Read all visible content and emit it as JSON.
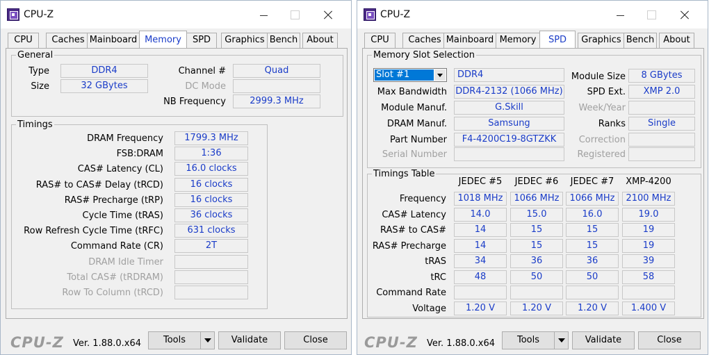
{
  "left_window": {
    "title": "CPU-Z",
    "tabs": [
      "CPU",
      "Caches",
      "Mainboard",
      "Memory",
      "SPD",
      "Graphics",
      "Bench",
      "About"
    ],
    "active_tab": "Memory",
    "general": {
      "legend": "General",
      "type_label": "Type",
      "type_value": "DDR4",
      "size_label": "Size",
      "size_value": "32 GBytes",
      "channel_label": "Channel #",
      "channel_value": "Quad",
      "dcmode_label": "DC Mode",
      "dcmode_value": "",
      "nbfreq_label": "NB Frequency",
      "nbfreq_value": "2999.3 MHz"
    },
    "timings": {
      "legend": "Timings",
      "rows": [
        {
          "label": "DRAM Frequency",
          "value": "1799.3 MHz",
          "disabled": false
        },
        {
          "label": "FSB:DRAM",
          "value": "1:36",
          "disabled": false
        },
        {
          "label": "CAS# Latency (CL)",
          "value": "16.0 clocks",
          "disabled": false
        },
        {
          "label": "RAS# to CAS# Delay (tRCD)",
          "value": "16 clocks",
          "disabled": false
        },
        {
          "label": "RAS# Precharge (tRP)",
          "value": "16 clocks",
          "disabled": false
        },
        {
          "label": "Cycle Time (tRAS)",
          "value": "36 clocks",
          "disabled": false
        },
        {
          "label": "Row Refresh Cycle Time (tRFC)",
          "value": "631 clocks",
          "disabled": false
        },
        {
          "label": "Command Rate (CR)",
          "value": "2T",
          "disabled": false
        },
        {
          "label": "DRAM Idle Timer",
          "value": "",
          "disabled": true
        },
        {
          "label": "Total CAS# (tRDRAM)",
          "value": "",
          "disabled": true
        },
        {
          "label": "Row To Column (tRCD)",
          "value": "",
          "disabled": true
        }
      ]
    },
    "footer": {
      "logo": "CPU-Z",
      "version": "Ver. 1.88.0.x64",
      "tools": "Tools",
      "validate": "Validate",
      "close": "Close"
    }
  },
  "right_window": {
    "title": "CPU-Z",
    "tabs": [
      "CPU",
      "Caches",
      "Mainboard",
      "Memory",
      "SPD",
      "Graphics",
      "Bench",
      "About"
    ],
    "active_tab": "SPD",
    "slot": {
      "legend": "Memory Slot Selection",
      "selected": "Slot #1",
      "type_value": "DDR4",
      "max_bw_label": "Max Bandwidth",
      "max_bw_value": "DDR4-2132 (1066 MHz)",
      "manuf_label": "Module Manuf.",
      "manuf_value": "G.Skill",
      "dram_manuf_label": "DRAM Manuf.",
      "dram_manuf_value": "Samsung",
      "part_label": "Part Number",
      "part_value": "F4-4200C19-8GTZKK",
      "serial_label": "Serial Number",
      "serial_value": "",
      "module_size_label": "Module Size",
      "module_size_value": "8 GBytes",
      "spd_ext_label": "SPD Ext.",
      "spd_ext_value": "XMP 2.0",
      "week_label": "Week/Year",
      "week_value": "",
      "ranks_label": "Ranks",
      "ranks_value": "Single",
      "correction_label": "Correction",
      "correction_value": "",
      "registered_label": "Registered",
      "registered_value": ""
    },
    "timings_table": {
      "legend": "Timings Table",
      "columns": [
        "JEDEC #5",
        "JEDEC #6",
        "JEDEC #7",
        "XMP-4200"
      ],
      "rows": [
        {
          "label": "Frequency",
          "values": [
            "1018 MHz",
            "1066 MHz",
            "1066 MHz",
            "2100 MHz"
          ]
        },
        {
          "label": "CAS# Latency",
          "values": [
            "14.0",
            "15.0",
            "16.0",
            "19.0"
          ]
        },
        {
          "label": "RAS# to CAS#",
          "values": [
            "14",
            "15",
            "15",
            "19"
          ]
        },
        {
          "label": "RAS# Precharge",
          "values": [
            "14",
            "15",
            "15",
            "19"
          ]
        },
        {
          "label": "tRAS",
          "values": [
            "34",
            "36",
            "36",
            "39"
          ]
        },
        {
          "label": "tRC",
          "values": [
            "48",
            "50",
            "50",
            "58"
          ]
        },
        {
          "label": "Command Rate",
          "values": [
            "",
            "",
            "",
            ""
          ]
        },
        {
          "label": "Voltage",
          "values": [
            "1.20 V",
            "1.20 V",
            "1.20 V",
            "1.400 V"
          ]
        }
      ]
    },
    "footer": {
      "logo": "CPU-Z",
      "version": "Ver. 1.88.0.x64",
      "tools": "Tools",
      "validate": "Validate",
      "close": "Close"
    }
  }
}
